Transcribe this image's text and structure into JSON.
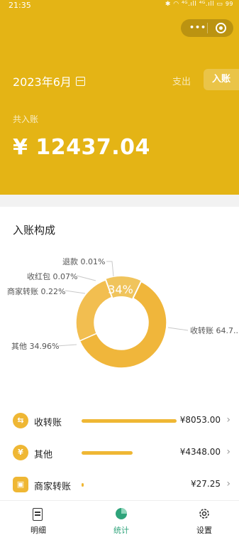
{
  "status": {
    "time": "21:35",
    "icons": "✱ ◠ ⁴ᴳ.ıll ⁴ᴳ.ıll ▭",
    "battery": "99"
  },
  "capsule": {
    "dots": "•••"
  },
  "header": {
    "month": "2023年6月",
    "tab_expense": "支出",
    "tab_income": "入账",
    "total_label": "共入账",
    "total_amount": "¥ 12437.04"
  },
  "composition": {
    "title": "入账构成",
    "center_label": "34%",
    "legend": [
      {
        "label": "收转账 64.7...",
        "percent": 64.74,
        "color": "#f0b63b"
      },
      {
        "label": "其他 34.96%",
        "percent": 34.96,
        "color": "#f2be50"
      },
      {
        "label": "商家转账 0.22%",
        "percent": 0.22,
        "color": "#f5cc71"
      },
      {
        "label": "收红包 0.07%",
        "percent": 0.07,
        "color": "#f7d58a"
      },
      {
        "label": "退款 0.01%",
        "percent": 0.01,
        "color": "#f9dfa4"
      }
    ]
  },
  "rows": [
    {
      "name": "收转账",
      "amount": "¥8053.00",
      "fraction": 1.0,
      "icon": "transfer-icon",
      "glyph": "⇆"
    },
    {
      "name": "其他",
      "amount": "¥4348.00",
      "fraction": 0.54,
      "icon": "coin-icon",
      "glyph": "¥"
    },
    {
      "name": "商家转账",
      "amount": "¥27.25",
      "fraction": 0.02,
      "icon": "shop-icon",
      "glyph": "▣"
    }
  ],
  "tabbar": {
    "detail": "明细",
    "stats": "统计",
    "settings": "设置",
    "active_color": "#2ea37a"
  },
  "colors": {
    "brand": "#e4b415",
    "accent": "#efb734"
  }
}
